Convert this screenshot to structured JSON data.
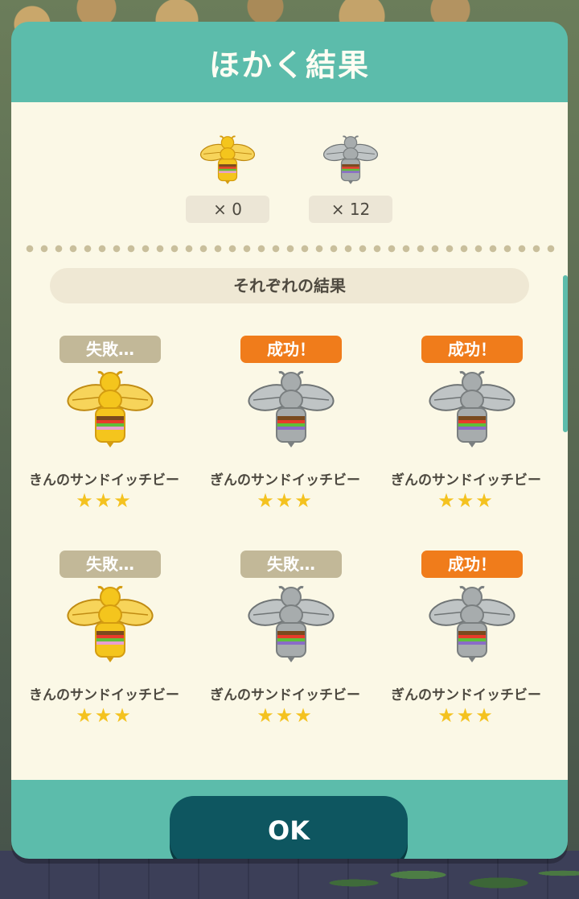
{
  "dialog": {
    "title": "ほかく結果",
    "summary": [
      {
        "variant": "gold",
        "icon": "gold-sandwich-bee-icon",
        "count": "× 0"
      },
      {
        "variant": "silver",
        "icon": "silver-sandwich-bee-icon",
        "count": "× 12"
      }
    ],
    "section_label": "それぞれの結果",
    "results": [
      {
        "status": "fail",
        "badge": "失敗…",
        "variant": "gold",
        "name": "きんのサンドイッチビー",
        "stars": "★★★"
      },
      {
        "status": "success",
        "badge": "成功！",
        "variant": "silver",
        "name": "ぎんのサンドイッチビー",
        "stars": "★★★"
      },
      {
        "status": "success",
        "badge": "成功！",
        "variant": "silver",
        "name": "ぎんのサンドイッチビー",
        "stars": "★★★"
      },
      {
        "status": "fail",
        "badge": "失敗…",
        "variant": "gold",
        "name": "きんのサンドイッチビー",
        "stars": "★★★"
      },
      {
        "status": "fail",
        "badge": "失敗…",
        "variant": "silver",
        "name": "ぎんのサンドイッチビー",
        "stars": "★★★"
      },
      {
        "status": "success",
        "badge": "成功！",
        "variant": "silver",
        "name": "ぎんのサンドイッチビー",
        "stars": "★★★"
      }
    ],
    "ok_label": "OK"
  },
  "colors": {
    "dialog_teal": "#5cbcab",
    "panel_cream": "#fbf8e6",
    "success_orange": "#f07c1b",
    "fail_khaki": "#c2b898",
    "ok_button": "#0e5660",
    "star_yellow": "#f4c21f"
  }
}
